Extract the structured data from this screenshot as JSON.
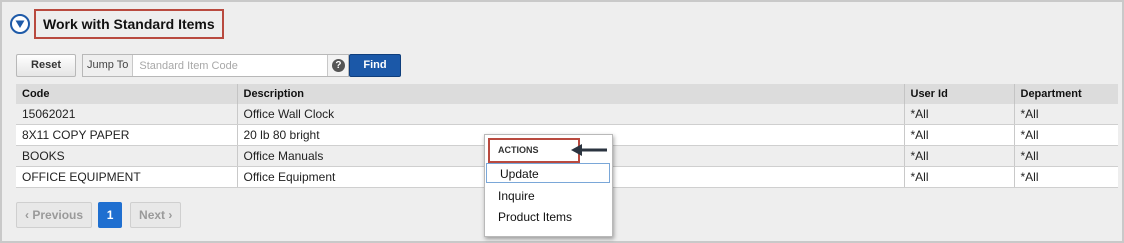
{
  "page": {
    "title": "Work with Standard Items",
    "filter_icon": "filter-funnel-icon"
  },
  "toolbar": {
    "reset_label": "Reset",
    "jump_to_label": "Jump To",
    "search_placeholder": "Standard Item Code",
    "help_label": "?",
    "find_label": "Find"
  },
  "table": {
    "headers": [
      "Code",
      "Description",
      "User Id",
      "Department"
    ],
    "rows": [
      [
        "15062021",
        "Office Wall Clock",
        "*All",
        "*All"
      ],
      [
        "8X11 COPY PAPER",
        "20 lb 80 bright",
        "*All",
        "*All"
      ],
      [
        "BOOKS",
        "Office Manuals",
        "*All",
        "*All"
      ],
      [
        "OFFICE EQUIPMENT",
        "Office Equipment",
        "*All",
        "*All"
      ]
    ]
  },
  "pagination": {
    "previous_label": "Previous",
    "current_page": "1",
    "next_label": "Next"
  },
  "context_menu": {
    "header": "ACTIONS",
    "items": [
      "Update",
      "Inquire",
      "Product Items"
    ]
  },
  "colors": {
    "highlight_border": "#b94a3f",
    "primary_button": "#1b58a8",
    "active_page": "#1f6fd0",
    "header_bg": "#dcdcdc",
    "row_alt_bg": "#eeeeee"
  }
}
